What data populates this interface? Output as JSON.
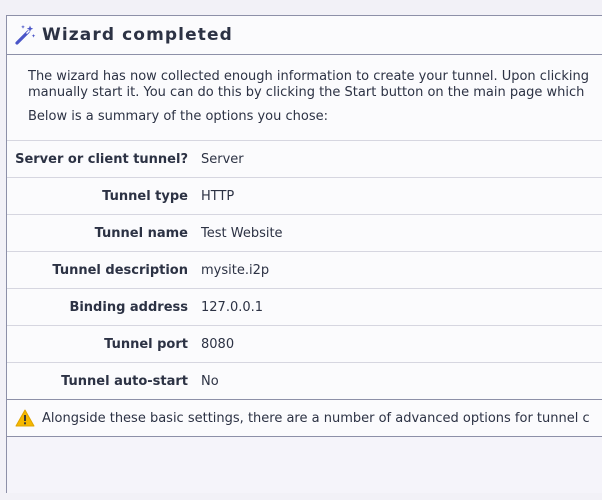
{
  "header": {
    "title": "Wizard completed",
    "icon": "magic-wand-icon"
  },
  "intro": {
    "line1": "The wizard has now collected enough information to create your tunnel. Upon clicking",
    "line2": "manually start it. You can do this by clicking the Start button on the main page which",
    "summary_intro": "Below is a summary of the options you chose:"
  },
  "summary": [
    {
      "label": "Server or client tunnel?",
      "value": "Server"
    },
    {
      "label": "Tunnel type",
      "value": "HTTP"
    },
    {
      "label": "Tunnel name",
      "value": "Test Website"
    },
    {
      "label": "Tunnel description",
      "value": "mysite.i2p"
    },
    {
      "label": "Binding address",
      "value": "127.0.0.1"
    },
    {
      "label": "Tunnel port",
      "value": "8080"
    },
    {
      "label": "Tunnel auto-start",
      "value": "No"
    }
  ],
  "notice": {
    "icon": "warning-icon",
    "text": "Alongside these basic settings, there are a number of advanced options for tunnel c"
  },
  "colors": {
    "warning": "#f5b800",
    "wand": "#4a55c8"
  }
}
